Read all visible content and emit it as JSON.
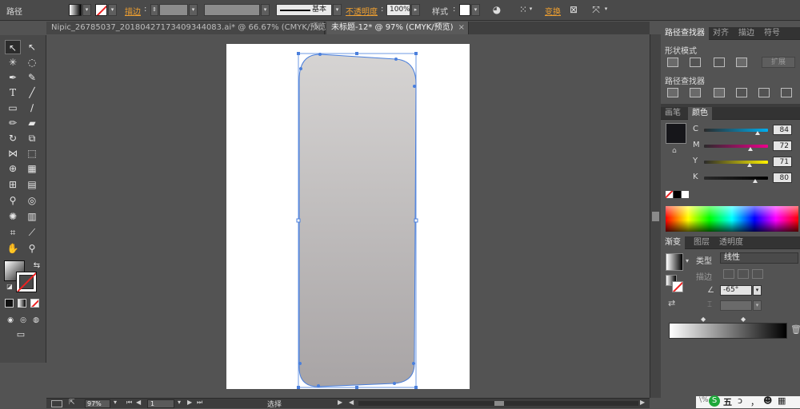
{
  "control_bar": {
    "object_type": "路径",
    "stroke_label": "描边",
    "stroke_value": "",
    "stroke_profile": "基本",
    "opacity_label": "不透明度",
    "opacity_value": "100%",
    "style_label": "样式",
    "transform_label": "变换"
  },
  "tabs": [
    {
      "label": "Nipic_26785037_20180427173409344083.ai* @ 66.67% (CMYK/预览)",
      "active": false
    },
    {
      "label": "未标题-12* @ 97% (CMYK/预览)",
      "active": true
    }
  ],
  "status_bar": {
    "zoom": "97%",
    "page": "1",
    "mode": "选择"
  },
  "pathfinder_panel": {
    "tabs": [
      "路径查找器",
      "对齐",
      "描边",
      "符号"
    ],
    "shape_modes_label": "形状模式",
    "expand_label": "扩展",
    "pathfinders_label": "路径查找器"
  },
  "color_panel": {
    "tabs": [
      "画笔",
      "颜色"
    ],
    "channels": [
      {
        "name": "C",
        "value": "84",
        "level": 0.84,
        "color": "#00aeef"
      },
      {
        "name": "M",
        "value": "72",
        "level": 0.72,
        "color": "#ec008c"
      },
      {
        "name": "Y",
        "value": "71",
        "level": 0.71,
        "color": "#fff200"
      },
      {
        "name": "K",
        "value": "80",
        "level": 0.8,
        "color": "#000000"
      }
    ],
    "fill_color": "#16161a"
  },
  "gradient_panel": {
    "tabs": [
      "渐变",
      "图层",
      "透明度"
    ],
    "type_label": "类型",
    "type_value": "线性",
    "stroke_label": "描边",
    "angle_value": "-65°",
    "gradient_start": "#ffffff",
    "gradient_end": "#000000"
  },
  "artwork": {
    "gradient_top": "#d6d4d3",
    "gradient_bottom": "#a8a4a5",
    "selection_color": "#4a7fdc"
  },
  "taskbar_icons": [
    "五",
    "ɔ",
    "，",
    "☻",
    "▦"
  ]
}
